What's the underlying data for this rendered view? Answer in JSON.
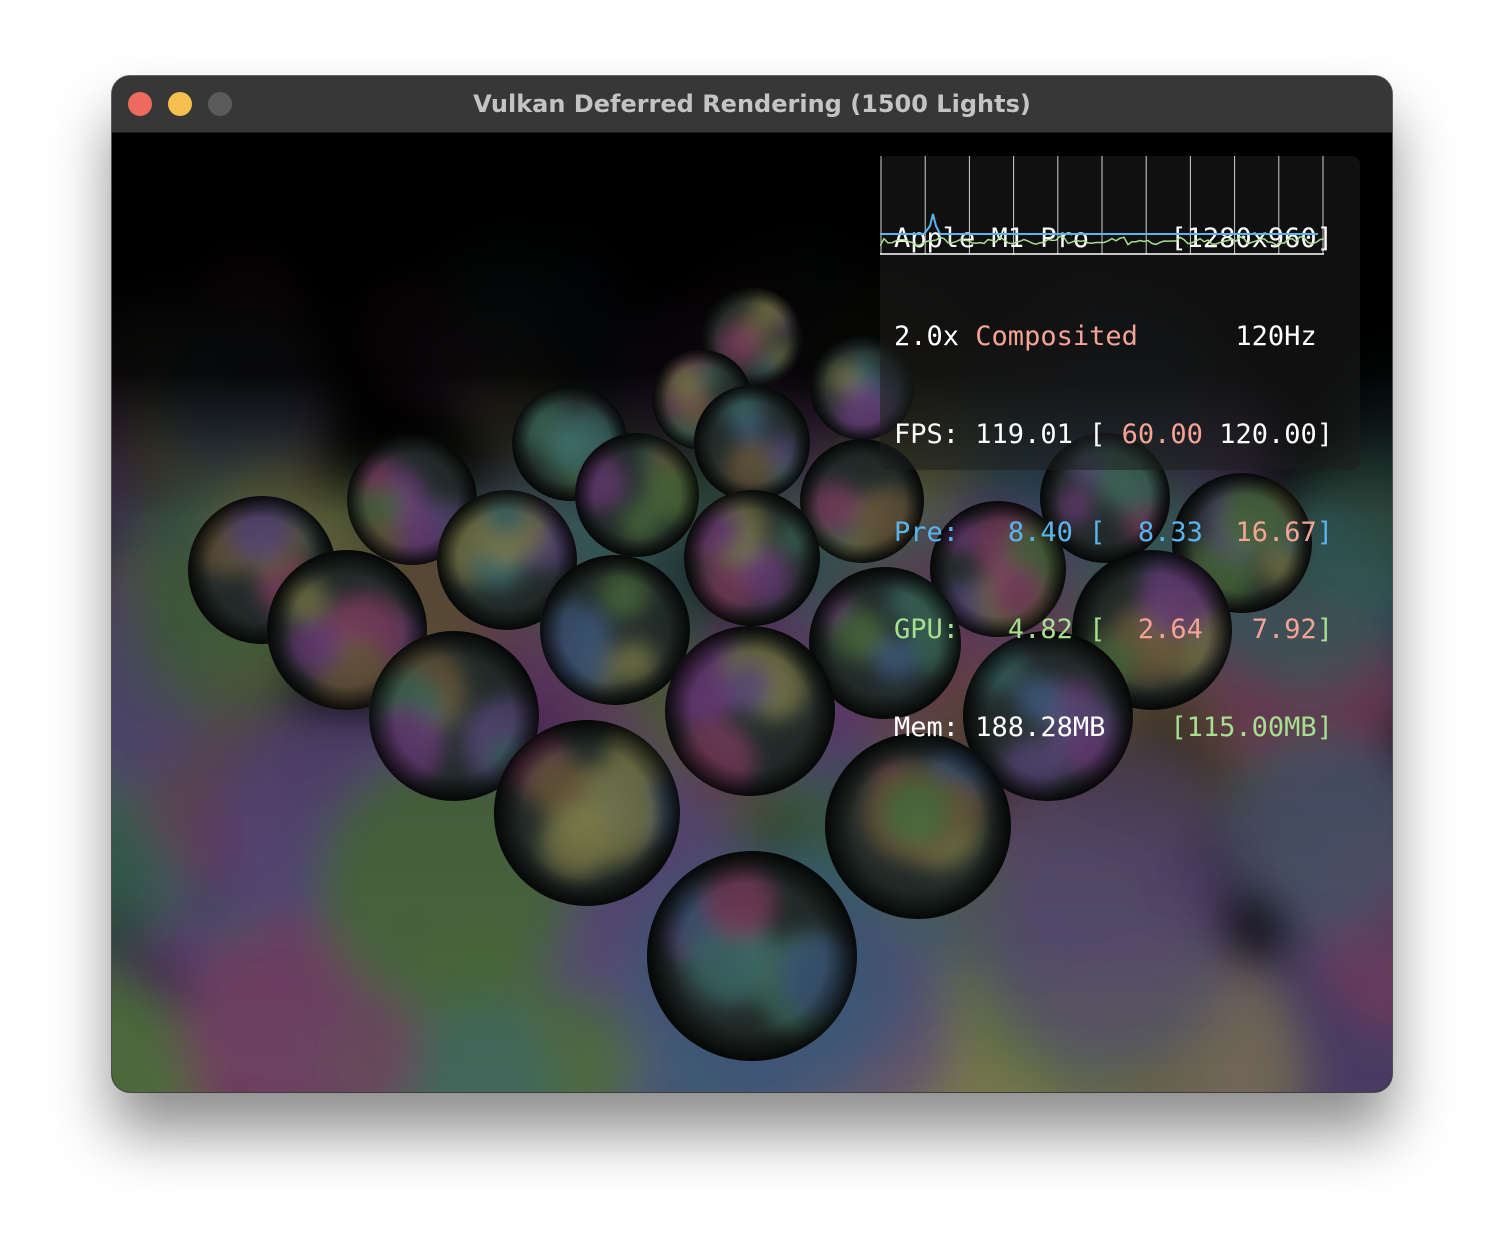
{
  "window": {
    "title": "Vulkan Deferred Rendering (1500 Lights)"
  },
  "overlay": {
    "device": "Apple M1 Pro",
    "resolution": "[1280x960]",
    "scale": "2.0x",
    "mode": "Composited",
    "refresh": "120Hz",
    "fps": {
      "label": "FPS:",
      "value": "119.01",
      "open": "[",
      "min": "60.00",
      "max": "120.00",
      "close": "]"
    },
    "pre": {
      "label": "Pre:",
      "value": "8.40",
      "open": "[",
      "min": "8.33",
      "max": "16.67",
      "close": "]"
    },
    "gpu": {
      "label": "GPU:",
      "value": "4.82",
      "open": "[",
      "min": "2.64",
      "max": "7.92",
      "close": "]"
    },
    "mem": {
      "label": "Mem:",
      "value": "188.28MB",
      "budget": "[115.00MB]"
    }
  },
  "colors": {
    "titlebar": "#373737",
    "close": "#ed6a5e",
    "minimize": "#f4bf4f",
    "zoom_disabled": "#5a5a5a",
    "stat_red": "#f4a394",
    "stat_blue": "#5ab4ee",
    "stat_green": "#a7df8f"
  }
}
